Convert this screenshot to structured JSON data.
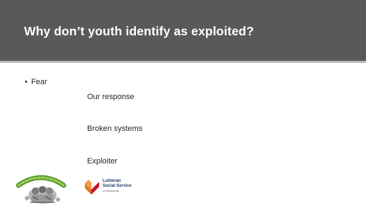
{
  "slide": {
    "title": "Why don’t youth identify as exploited?",
    "bullet_symbol": "•",
    "bullet": "Fear",
    "sub_items": [
      "Our response",
      "Broken systems",
      "Exploiter"
    ]
  },
  "logos": {
    "streetworks": {
      "icon": "streetworks-logo"
    },
    "lss": {
      "icon": "lutheran-social-service-logo",
      "line1": "Lutheran",
      "line2": "Social Service",
      "line3": "of Minnesota"
    }
  },
  "colors": {
    "title_bar": "#595959",
    "title_text": "#ffffff",
    "body_text": "#262626",
    "lss_orange": "#e8731e",
    "lss_red": "#c8102e",
    "lss_navy": "#1f3864"
  }
}
